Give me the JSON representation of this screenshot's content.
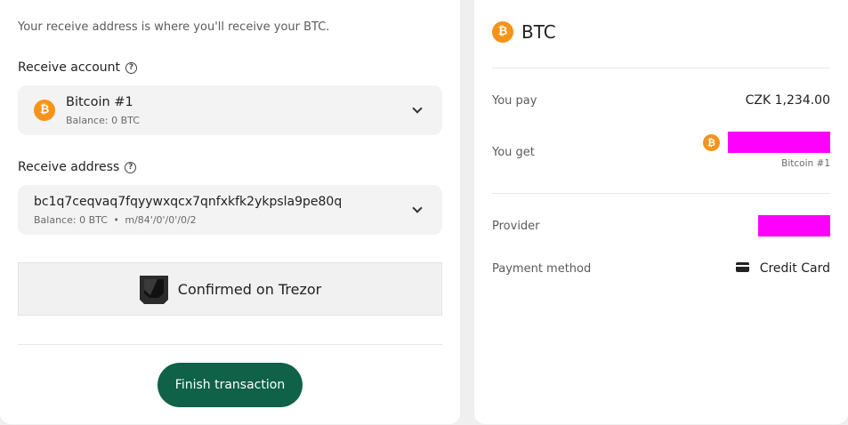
{
  "receive": {
    "intro": "Your receive address is where you'll receive your BTC.",
    "account_label": "Receive account",
    "help_glyph": "?",
    "account": {
      "icon": "bitcoin-icon",
      "icon_glyph": "₿",
      "name": "Bitcoin #1",
      "balance": "Balance: 0 BTC"
    },
    "address_label": "Receive address",
    "address": {
      "value": "bc1q7ceqvaq7fqyywxqcx7qnfxkfk2ykpsla9pe80q",
      "balance": "Balance: 0 BTC",
      "separator": "•",
      "path": "m/84'/0'/0'/0/2"
    },
    "confirmed_text": "Confirmed on Trezor",
    "finish_button": "Finish transaction"
  },
  "summary": {
    "coin_title": "BTC",
    "coin_glyph": "₿",
    "you_pay_label": "You pay",
    "you_pay_value": "CZK 1,234.00",
    "you_get_label": "You get",
    "you_get_account": "Bitcoin #1",
    "provider_label": "Provider",
    "payment_method_label": "Payment method",
    "payment_method_value": "Credit Card"
  },
  "colors": {
    "accent": "#0f6148",
    "bitcoin": "#f7931a",
    "redaction": "#ff00ff"
  }
}
